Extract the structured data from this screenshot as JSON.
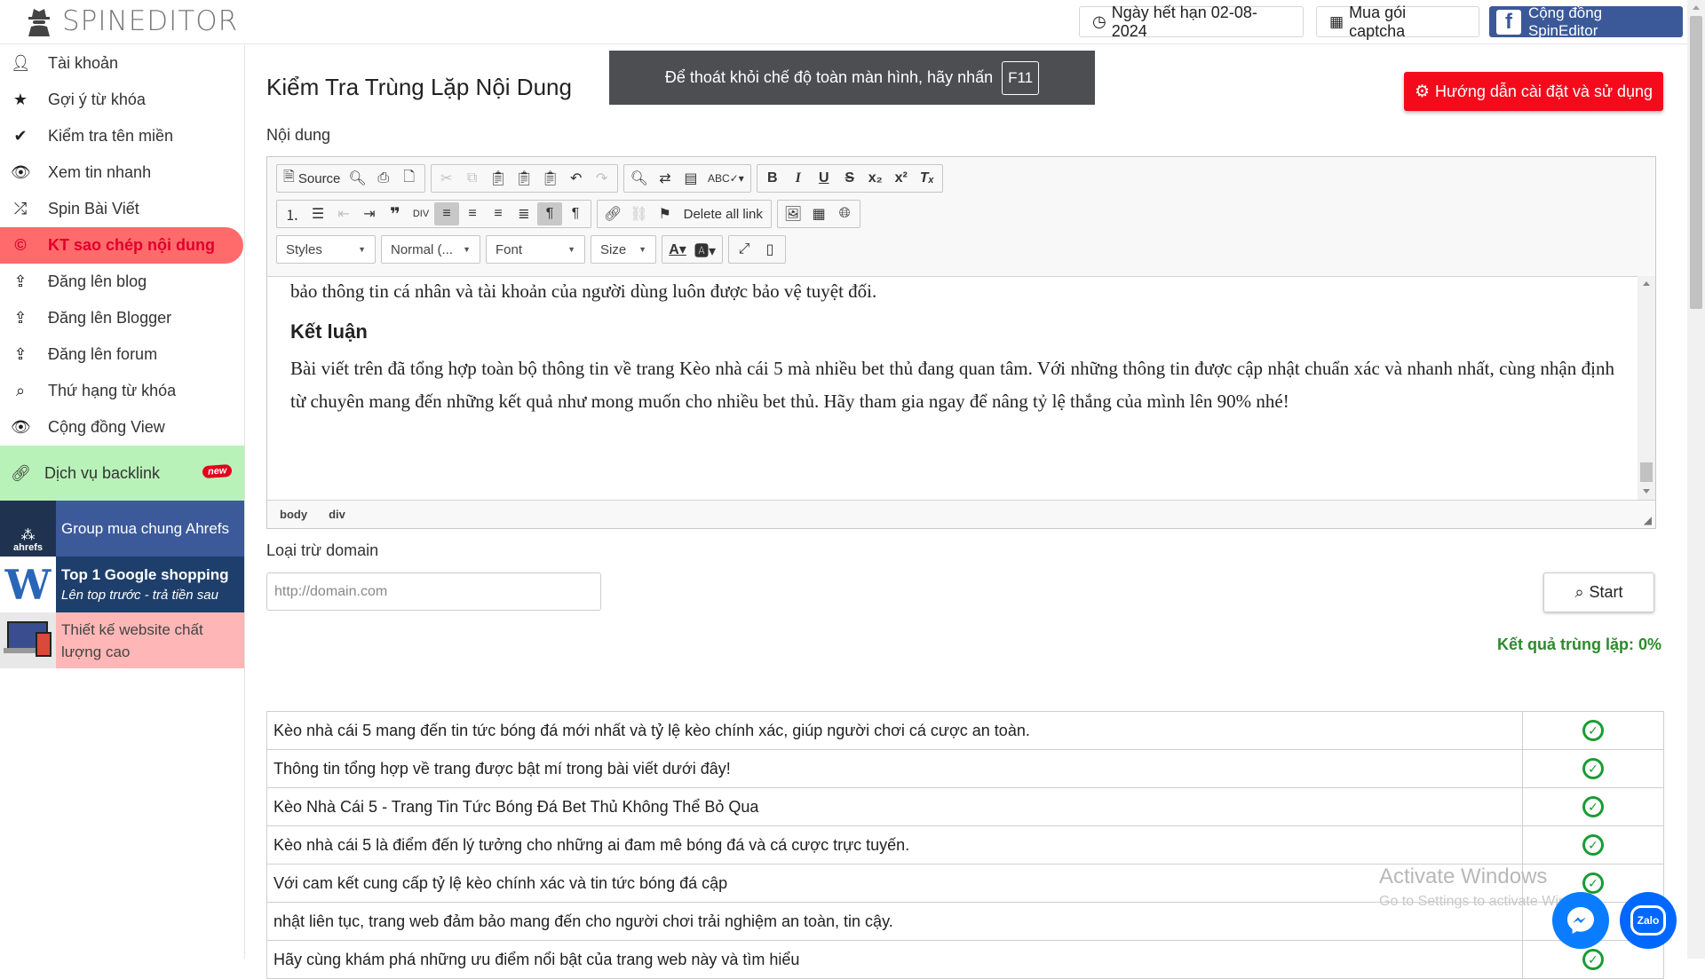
{
  "app": {
    "logo_text": "SPINEDITOR"
  },
  "topbar": {
    "expiry": "Ngày hết hạn 02-08-2024",
    "captcha": "Mua gói captcha",
    "community": "Cộng đồng SpinEditor"
  },
  "sidebar": {
    "items": [
      {
        "label": "Tài khoản",
        "icon": "user-icon"
      },
      {
        "label": "Gợi ý từ khóa",
        "icon": "star-icon"
      },
      {
        "label": "Kiểm tra tên miền",
        "icon": "check-icon"
      },
      {
        "label": "Xem tin nhanh",
        "icon": "eye-icon"
      },
      {
        "label": "Spin Bài Viết",
        "icon": "shuffle-icon"
      },
      {
        "label": "KT sao chép nội dung",
        "icon": "copyright-icon"
      },
      {
        "label": "Đăng lên blog",
        "icon": "upload-icon"
      },
      {
        "label": "Đăng lên Blogger",
        "icon": "upload-icon"
      },
      {
        "label": "Đăng lên forum",
        "icon": "upload-icon"
      },
      {
        "label": "Thứ hạng từ khóa",
        "icon": "search-icon"
      },
      {
        "label": "Cộng đồng View",
        "icon": "eye-icon"
      }
    ],
    "backlink": {
      "label": "Dịch vụ backlink",
      "badge": "new"
    },
    "promos": [
      {
        "title": "Group mua chung Ahrefs",
        "subtitle": "",
        "logo": "ahrefs"
      },
      {
        "title": "Top 1 Google shopping",
        "subtitle": "Lên top trước - trả tiền sau",
        "logo": ""
      },
      {
        "title": "Thiết kế website chất lượng cao",
        "subtitle": "",
        "logo": ""
      }
    ]
  },
  "main": {
    "title": "Kiểm Tra Trùng Lặp Nội Dung",
    "fullscreen_notice": "Để thoát khỏi chế độ toàn màn hình, hãy nhấn",
    "fullscreen_key": "F11",
    "guide_button": "Hướng dẫn cài đặt và sử dụng",
    "content_label": "Nội dung",
    "exclude_label": "Loại trừ domain",
    "domain_placeholder": "http://domain.com",
    "start_button": "Start",
    "result_text": "Kết quả trùng lặp: 0%"
  },
  "editor": {
    "source_label": "Source",
    "delete_links": "Delete all link",
    "styles": "Styles",
    "format": "Normal (...",
    "font": "Font",
    "size": "Size",
    "para1": "bảo thông tin cá nhân và tài khoản của người dùng luôn được bảo vệ tuyệt đối.",
    "heading": "Kết luận",
    "para2": "Bài viết trên đã tổng hợp toàn bộ thông tin về trang Kèo nhà cái 5 mà nhiều bet thủ đang quan tâm. Với những thông tin được cập nhật chuẩn xác và nhanh nhất, cùng nhận định từ chuyên mang đến những kết quả như mong muốn cho nhiều bet thủ. Hãy tham gia ngay để nâng tỷ lệ thắng của mình lên 90% nhé!",
    "path": [
      "body",
      "div"
    ]
  },
  "results": [
    "Kèo nhà cái 5 mang đến tin tức bóng đá mới nhất và tỷ lệ kèo chính xác, giúp người chơi cá cược an toàn.",
    "Thông tin tổng hợp về trang được bật mí trong bài viết dưới đây!",
    "Kèo Nhà Cái 5 - Trang Tin Tức Bóng Đá Bet Thủ Không Thể Bỏ Qua",
    "Kèo nhà cái 5 là điểm đến lý tưởng cho những ai đam mê bóng đá và cá cược trực tuyến.",
    "Với cam kết cung cấp tỷ lệ kèo chính xác và tin tức bóng đá cập",
    "nhật liên tục, trang web đảm bảo mang đến cho người chơi trải nghiệm an toàn, tin cậy.",
    "Hãy cùng khám phá những ưu điểm nổi bật của trang web này và tìm hiểu"
  ],
  "watermark": {
    "line1": "Activate Windows",
    "line2": "Go to Settings to activate Windows."
  },
  "chat": {
    "zalo_label": "Zalo"
  },
  "colors": {
    "active_bg": "#ff6b6b",
    "guide_bg": "#f50a1c",
    "success": "#1a9b35",
    "fb": "#3b5998"
  }
}
